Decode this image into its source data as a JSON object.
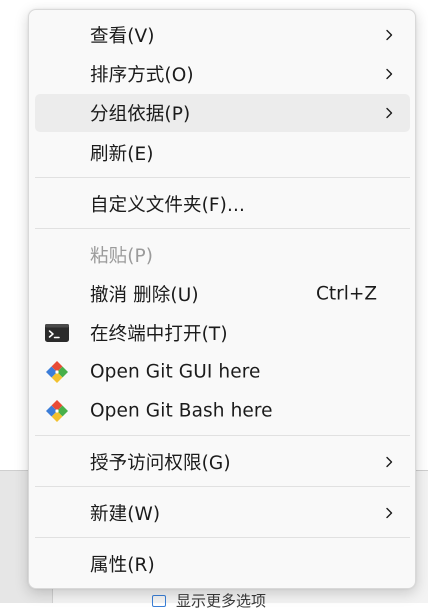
{
  "menu": {
    "items": [
      {
        "label": "查看(V)"
      },
      {
        "label": "排序方式(O)"
      },
      {
        "label": "分组依据(P)"
      },
      {
        "label": "刷新(E)"
      },
      {
        "label": "自定义文件夹(F)..."
      },
      {
        "label": "粘贴(P)"
      },
      {
        "label": "撤消 删除(U)",
        "shortcut": "Ctrl+Z"
      },
      {
        "label": "在终端中打开(T)"
      },
      {
        "label": "Open Git GUI here"
      },
      {
        "label": "Open Git Bash here"
      },
      {
        "label": "授予访问权限(G)"
      },
      {
        "label": "新建(W)"
      },
      {
        "label": "属性(R)"
      }
    ]
  },
  "background": {
    "more_options_label": "显示更多选项"
  },
  "icons": {
    "submenu": "chevron-right-icon",
    "terminal": "terminal-icon",
    "git": "git-icon"
  },
  "colors": {
    "menu_bg": "#f9f9f9",
    "hover_bg": "#ececec",
    "disabled_text": "#9b9b9b",
    "git_red": "#e94b35",
    "git_blue": "#3b7dd8",
    "git_green": "#48b04a",
    "git_yellow": "#f2c12e"
  }
}
